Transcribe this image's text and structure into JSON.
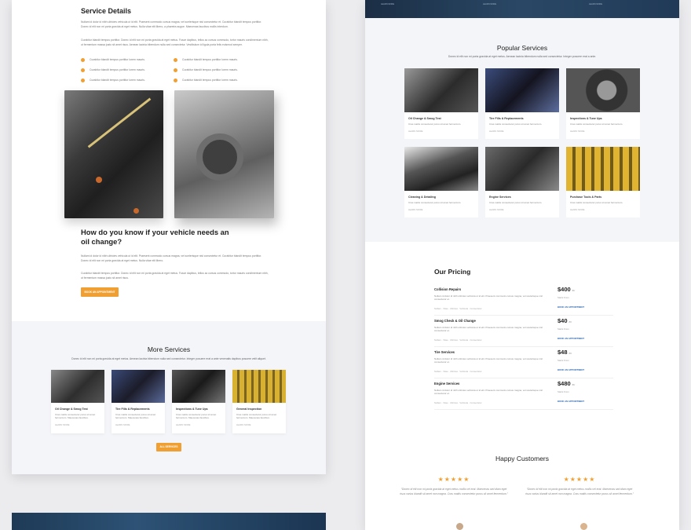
{
  "left": {
    "service_details": {
      "title": "Service Details",
      "para1": "Nullam id dolor id nibh ultricies vehicula ut id elit. Praesent commodo cursus magna, vel scelerisque nisl consectetur et. Curabitur blandit tempus porttitor. Donec id elit non mi porta gravida at eget metus. Nulla vitae elit libero, a pharetra augue. Maecenas faucibus mollis interdum.",
      "para2": "Curabitur blandit tempus porttitor. Donec id elit non mi porta gravida at eget metus. Fusce dapibus, tellus ac cursus commodo, tortor mauris condimentum nibh, ut fermentum massa justo sit amet risus. Aenean lacinia bibendum nulla sed consectetur. Vestibulum id ligula porta felis euismod semper.",
      "checklist": [
        "Curabitur blandit tempus porttitor lorem mauris.",
        "Curabitur blandit tempus porttitor lorem mauris.",
        "Curabitur blandit tempus porttitor lorem mauris.",
        "Curabitur blandit tempus porttitor lorem mauris.",
        "Curabitur blandit tempus porttitor lorem mauris.",
        "Curabitur blandit tempus porttitor lorem mauris."
      ]
    },
    "question": {
      "title": "How do you know if your vehicle needs an oil change?",
      "para1": "Nullam id dolor id nibh ultricies vehicula ut id elit. Praesent commodo cursus magna, vel scelerisque nisl consectetur et. Curabitur blandit tempus porttitor. Donec id elit non mi porta gravida at eget metus. Nulla vitae elit libero.",
      "para2": "Curabitur blandit tempus porttitor. Donec id elit non mi porta gravida at eget metus. Fusce dapibus, tellus ac cursus commodo, tortor mauris condimentum nibh, ut fermentum massa justo sit amet risus.",
      "button": "BOOK AN APPOINTMENT"
    },
    "more_services": {
      "title": "More Services",
      "subtitle": "Donec id elit non mi porta gravida at eget metus. Aenean lacinia bibendum nulla sed consectetur. Integer posuere erat a ante venenatis dapibus posuere velit aliquet.",
      "cards": [
        {
          "title": "Oil Change & Smog Test",
          "desc": "Cras mattis consectetur purus sit amet fermentum. Maecenas faucibus.",
          "link": "LEARN MORE"
        },
        {
          "title": "Tire Fills & Replacements",
          "desc": "Cras mattis consectetur purus sit amet fermentum. Maecenas faucibus.",
          "link": "LEARN MORE"
        },
        {
          "title": "Inspections & Tune Ups",
          "desc": "Cras mattis consectetur purus sit amet fermentum. Maecenas faucibus.",
          "link": "LEARN MORE"
        },
        {
          "title": "General Inspection",
          "desc": "Cras mattis consectetur purus sit amet fermentum. Maecenas faucibus.",
          "link": "LEARN MORE"
        }
      ],
      "button": "ALL SERVICES"
    }
  },
  "right": {
    "hero": {
      "link1": "LEARN MORE",
      "link2": "LEARN MORE",
      "link3": "LEARN MORE"
    },
    "popular": {
      "title": "Popular Services",
      "subtitle": "Donec id elit non mi porta gravida at eget metus. Aenean lacinia bibendum nulla sed consectetur. Integer posuere erat a ante.",
      "cards": [
        {
          "title": "Oil Change & Smog Test",
          "desc": "Cras mattis consectetur purus sit amet fermentum.",
          "link": "LEARN MORE"
        },
        {
          "title": "Tire Fills & Replacements",
          "desc": "Cras mattis consectetur purus sit amet fermentum.",
          "link": "LEARN MORE"
        },
        {
          "title": "Inspections & Tune Ups",
          "desc": "Cras mattis consectetur purus sit amet fermentum.",
          "link": "LEARN MORE"
        },
        {
          "title": "Cleaning & Detailing",
          "desc": "Cras mattis consectetur purus sit amet fermentum.",
          "link": "LEARN MORE"
        },
        {
          "title": "Engine Services",
          "desc": "Cras mattis consectetur purus sit amet fermentum.",
          "link": "LEARN MORE"
        },
        {
          "title": "Purchase Tools & Parts",
          "desc": "Cras mattis consectetur purus sit amet fermentum.",
          "link": "LEARN MORE"
        }
      ]
    },
    "pricing": {
      "title": "Our Pricing",
      "items": [
        {
          "name": "Collision Repairs",
          "desc": "Nullam id dolor id nibh ultricies vehicula ut id elit. Praesent commodo cursus magna, vel scelerisque nisl consectetur et.",
          "features": "Nullam · Vitae · Ultricies · Vehicula · Consectetur",
          "price": "$400",
          "per": "/hr",
          "starts": "Starts From",
          "book": "BOOK AN APPOINTMENT"
        },
        {
          "name": "Smog Check & Oil Change",
          "desc": "Nullam id dolor id nibh ultricies vehicula ut id elit. Praesent commodo cursus magna, vel scelerisque nisl consectetur et.",
          "features": "Nullam · Vitae · Ultricies · Vehicula · Consectetur",
          "price": "$40",
          "per": "/hr",
          "starts": "Starts From",
          "book": "BOOK AN APPOINTMENT"
        },
        {
          "name": "Tire Services",
          "desc": "Nullam id dolor id nibh ultricies vehicula ut id elit. Praesent commodo cursus magna, vel scelerisque nisl consectetur et.",
          "features": "Nullam · Vitae · Ultricies · Vehicula · Consectetur",
          "price": "$48",
          "per": "/hr",
          "starts": "Starts From",
          "book": "BOOK AN APPOINTMENT"
        },
        {
          "name": "Engine Services",
          "desc": "Nullam id dolor id nibh ultricies vehicula ut id elit. Praesent commodo cursus magna, vel scelerisque nisl consectetur et.",
          "features": "Nullam · Vitae · Ultricies · Vehicula · Consectetur",
          "price": "$480",
          "per": "/hr",
          "starts": "Starts From",
          "book": "BOOK AN APPOINTMENT"
        }
      ]
    },
    "happy": {
      "title": "Happy Customers",
      "testimonials": [
        {
          "stars": "★★★★★",
          "quote": "“Donec id elit non mi porta gravida at eget metus mollis vel erat. Maecenas sed diam eget risus varius blandit sit amet non magna. Cras mattis consectetur purus sit amet fermentum.”"
        },
        {
          "stars": "★★★★★",
          "quote": "“Donec id elit non mi porta gravida at eget metus mollis vel erat. Maecenas sed diam eget risus varius blandit sit amet non magna. Cras mattis consectetur purus sit amet fermentum.”"
        }
      ]
    }
  },
  "colors": {
    "accent": "#f0a032",
    "link": "#2b67b0",
    "section_bg": "#f4f5f8",
    "hero": "#1e3a56"
  }
}
